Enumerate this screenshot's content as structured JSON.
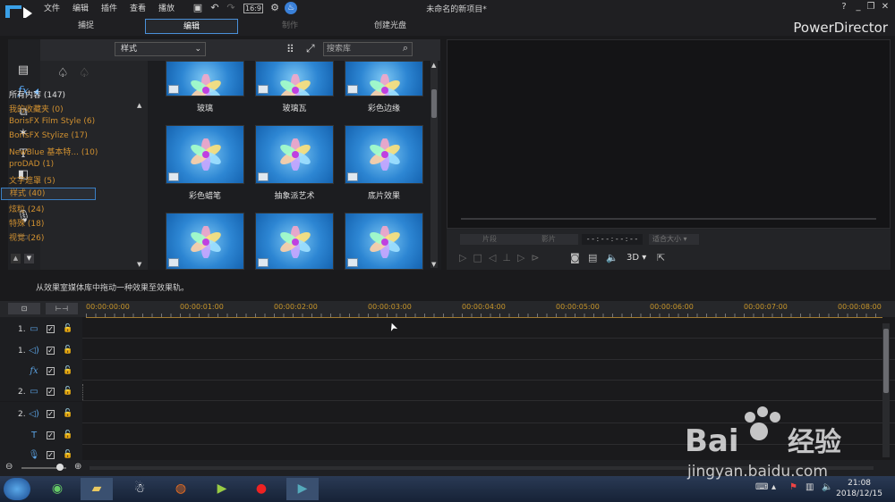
{
  "menu": [
    "文件",
    "编辑",
    "插件",
    "查看",
    "播放"
  ],
  "doc_title": "未命名的新项目*",
  "brand": "PowerDirector",
  "win_controls": [
    "?",
    "_",
    "❐",
    "✕"
  ],
  "tabs": [
    {
      "label": "捕捉"
    },
    {
      "label": "编辑"
    },
    {
      "label": "制作"
    },
    {
      "label": "创建光盘"
    }
  ],
  "categories": [
    {
      "label": "所有内容 (147)"
    },
    {
      "label": "我的收藏夹 (0)"
    },
    {
      "label": "BorisFX Film Style (6)"
    },
    {
      "label": "BorisFX Stylize (17)"
    },
    {
      "label": "NewBlue 基本特... (10)"
    },
    {
      "label": "proDAD (1)"
    },
    {
      "label": "文字遮罩 (5)"
    },
    {
      "label": "样式 (40)"
    },
    {
      "label": "炫粒 (24)"
    },
    {
      "label": "特殊 (18)"
    },
    {
      "label": "视觉 (26)"
    }
  ],
  "style_select": "样式",
  "search_placeholder": "搜索库",
  "thumbs": [
    {
      "label": "玻璃"
    },
    {
      "label": "玻璃瓦"
    },
    {
      "label": "彩色边缘"
    },
    {
      "label": "彩色蜡笔"
    },
    {
      "label": "抽象派艺术"
    },
    {
      "label": "底片效果"
    },
    {
      "label": ""
    },
    {
      "label": ""
    },
    {
      "label": ""
    }
  ],
  "preview": {
    "btn1": "片段",
    "btn2": "影片",
    "timecode": "- - : - - : - - : - -",
    "size": "适合大小",
    "mode3d": "3D"
  },
  "hint": "从效果室媒体库中拖动一种效果至效果轨。",
  "ruler": [
    "00:00:00:00",
    "00:00:01:00",
    "00:00:02:00",
    "00:00:03:00",
    "00:00:04:00",
    "00:00:05:00",
    "00:00:06:00",
    "00:00:07:00",
    "00:00:08:00"
  ],
  "tracks": [
    {
      "num": "1.",
      "icon": "video-track-icon"
    },
    {
      "num": "1.",
      "icon": "audio-track-icon"
    },
    {
      "num": "",
      "icon": "fx-track-icon"
    },
    {
      "num": "2.",
      "icon": "video-track-icon"
    },
    {
      "num": "2.",
      "icon": "audio-track-icon"
    },
    {
      "num": "",
      "icon": "title-track-icon"
    },
    {
      "num": "",
      "icon": "voice-track-icon"
    }
  ],
  "clock": {
    "time": "21:08",
    "date": "2018/12/15"
  },
  "colors": {
    "accent": "#4a90d9",
    "category": "#d09030",
    "ruler": "#c8962a"
  }
}
